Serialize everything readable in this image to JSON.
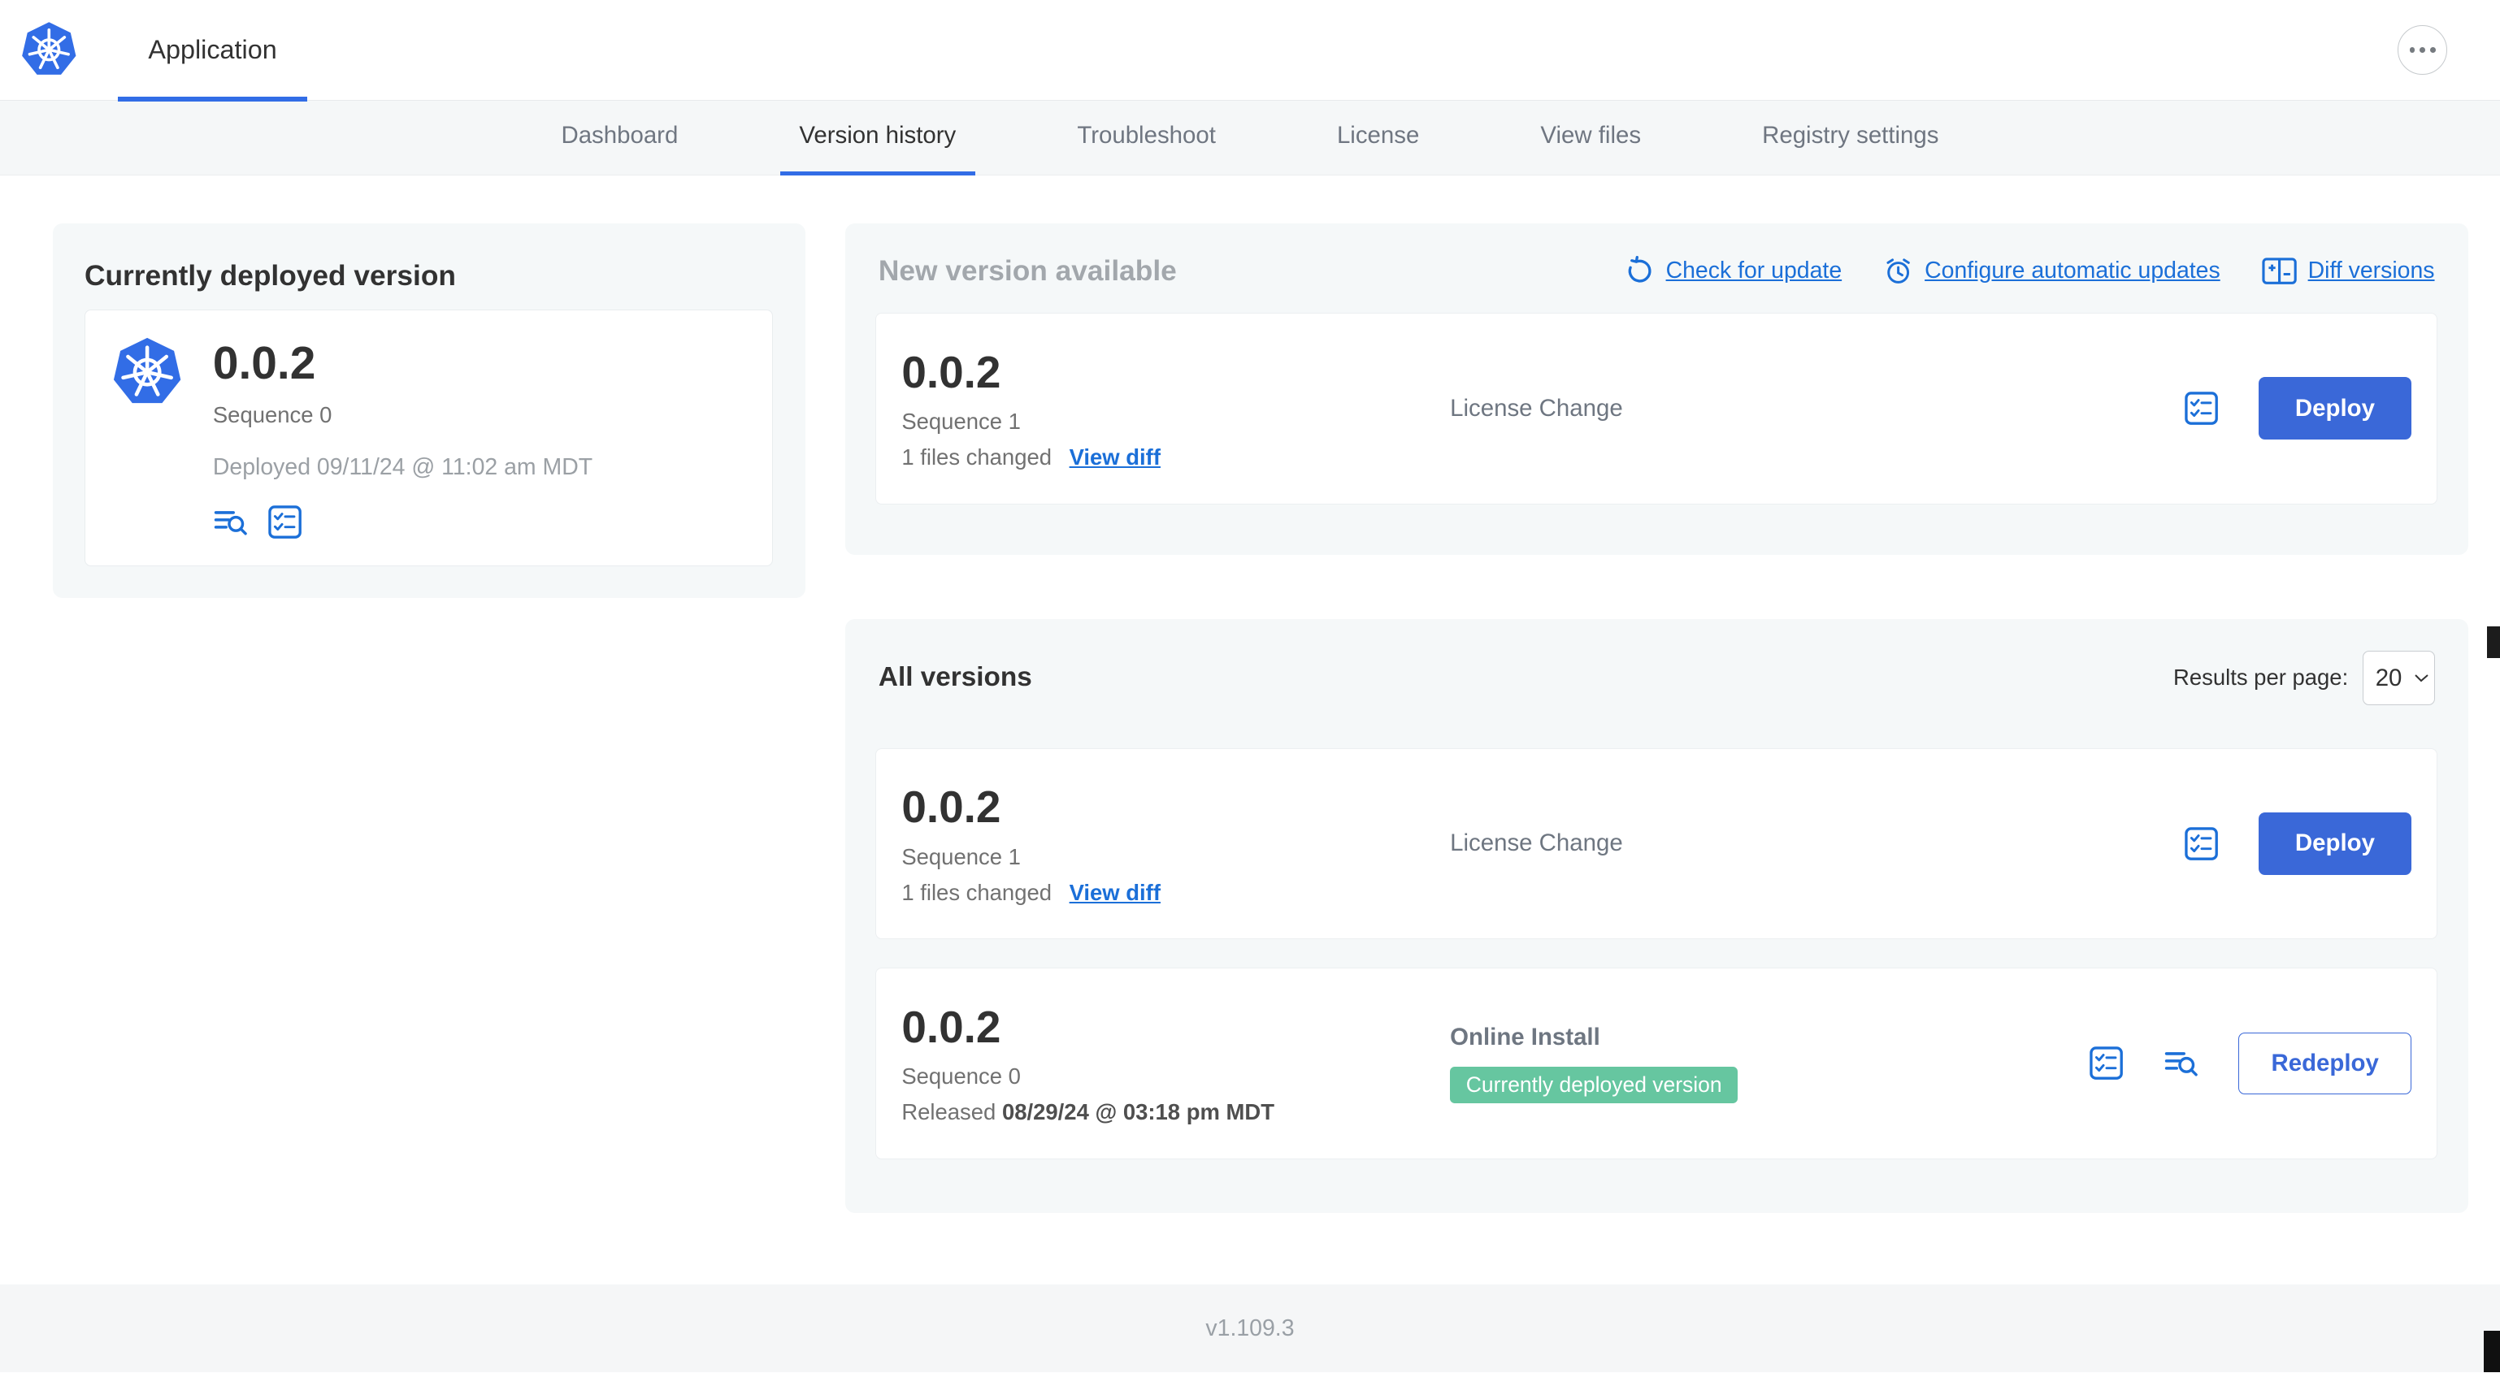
{
  "colors": {
    "accent": "#326de6",
    "link": "#1b6fd8",
    "button_blue": "#3a68d8",
    "badge_green": "#66c6a0",
    "panel_gray": "#f5f8f9"
  },
  "header": {
    "app_tab_label": "Application"
  },
  "nav": {
    "active_tab": "Version history",
    "tabs": [
      "Dashboard",
      "Version history",
      "Troubleshoot",
      "License",
      "View files",
      "Registry settings"
    ]
  },
  "current_version": {
    "title": "Currently deployed version",
    "version": "0.0.2",
    "sequence": "Sequence 0",
    "deployed_text": "Deployed 09/11/24 @ 11:02 am MDT"
  },
  "new_version": {
    "title": "New version available",
    "check_for_update_label": "Check for update",
    "configure_auto_updates_label": "Configure automatic updates",
    "diff_versions_label": "Diff versions",
    "card": {
      "version": "0.0.2",
      "sequence": "Sequence 1",
      "files_changed": "1 files changed",
      "view_diff_label": "View diff",
      "source": "License Change",
      "deploy_label": "Deploy"
    }
  },
  "all_versions": {
    "title": "All versions",
    "results_per_page_label": "Results per page:",
    "results_per_page_value": "20",
    "rows": [
      {
        "version": "0.0.2",
        "sequence": "Sequence 1",
        "files_changed": "1 files changed",
        "view_diff_label": "View diff",
        "source": "License Change",
        "action_label": "Deploy"
      },
      {
        "version": "0.0.2",
        "sequence": "Sequence 0",
        "released_label": "Released",
        "released_date": "08/29/24 @ 03:18 pm MDT",
        "source": "Online Install",
        "status_badge": "Currently deployed version",
        "action_label": "Redeploy"
      }
    ]
  },
  "footer": {
    "console_version": "v1.109.3"
  },
  "icons": {
    "kubernetes-logo-icon": "blue heptagon with white helm wheel",
    "ellipsis-icon": "⋯",
    "refresh-icon": "↺",
    "auto-update-clock-icon": "clock with update ticks",
    "diff-icon": "split table with plus/minus",
    "release-notes-icon": "text lines with magnifier",
    "checklist-icon": "boxed checklist",
    "select-chevron-icon": "▾"
  }
}
